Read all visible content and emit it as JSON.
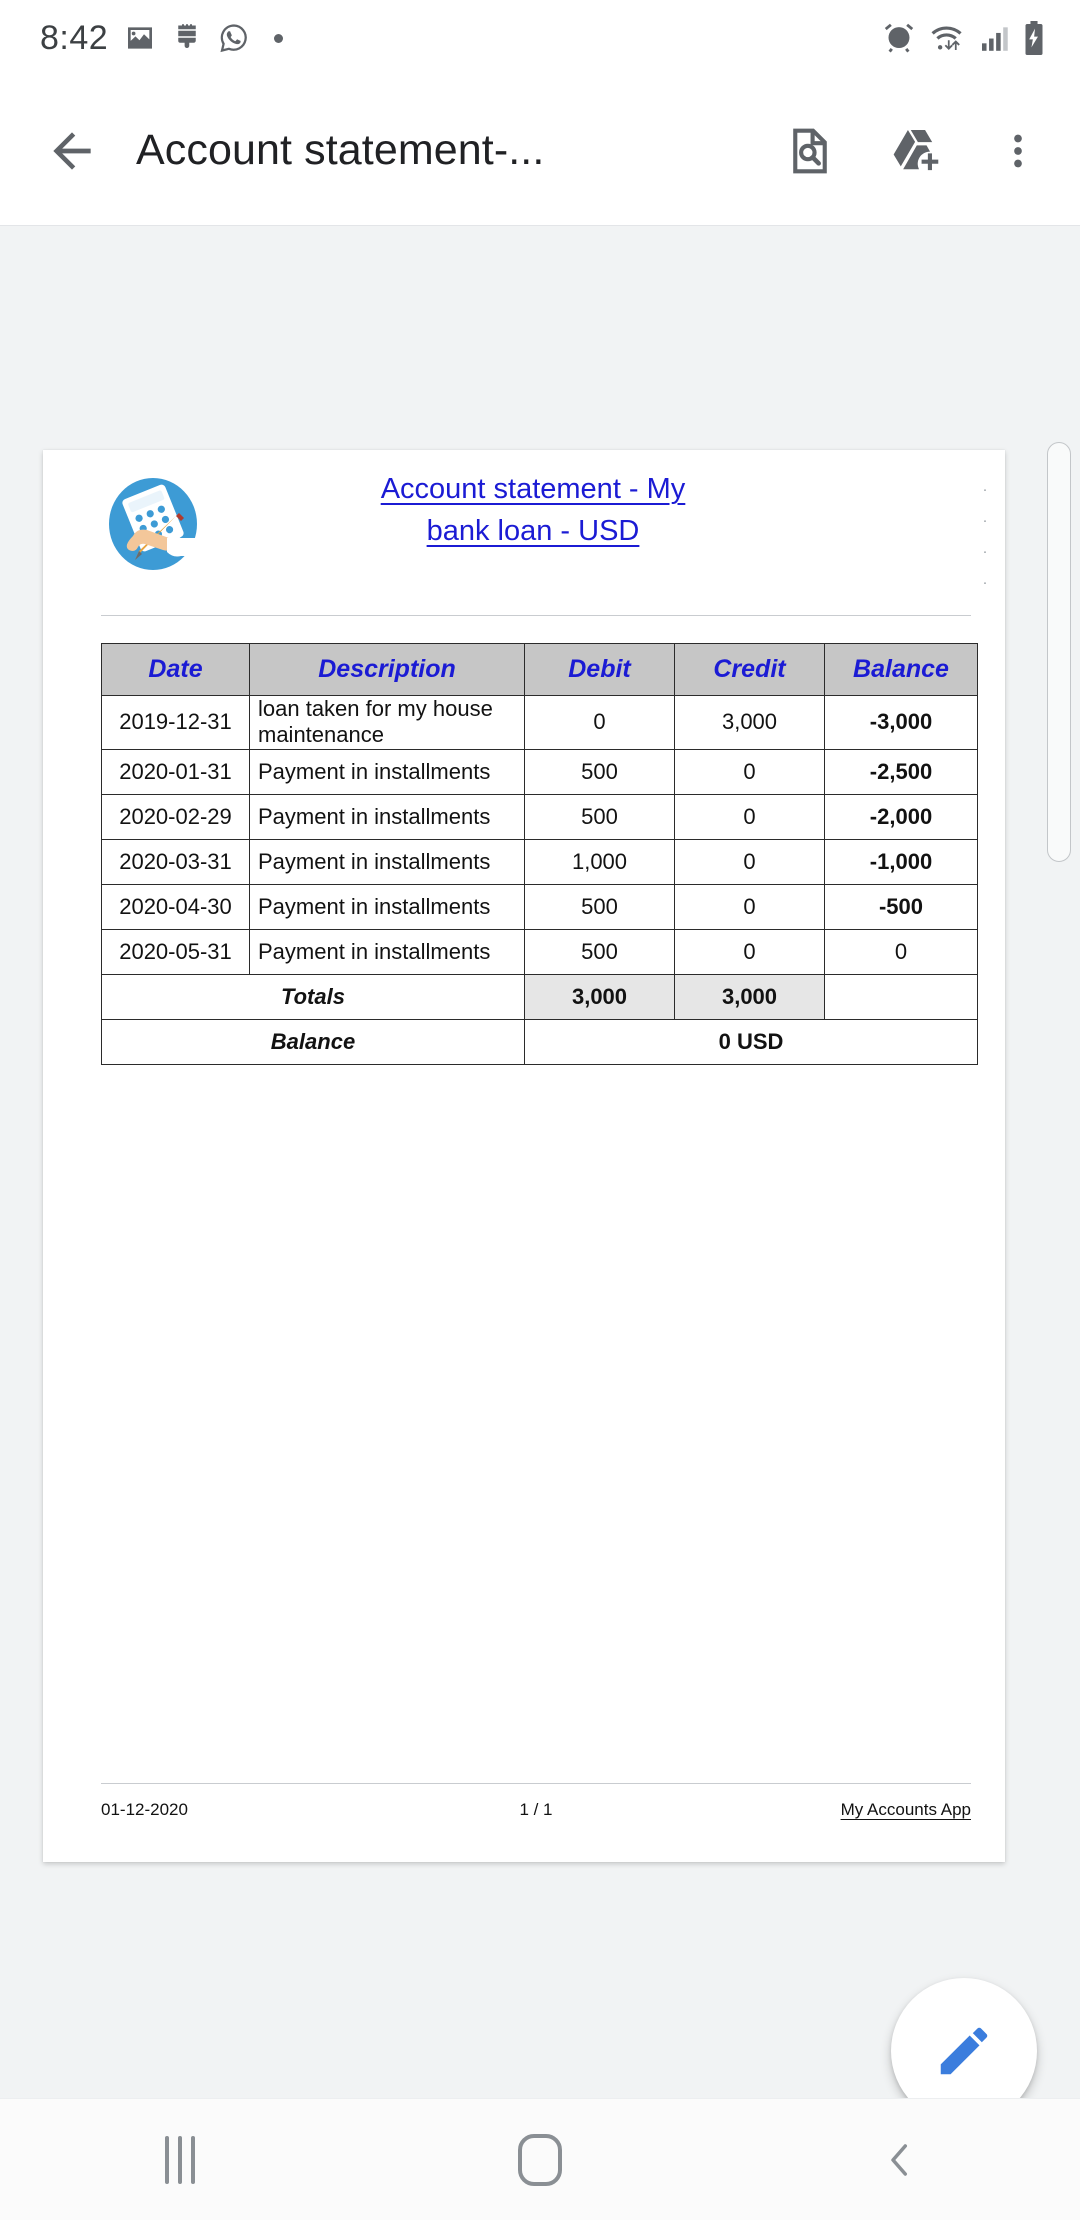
{
  "status_bar": {
    "time": "8:42",
    "left_icons": [
      "image-icon",
      "paintbrush-icon",
      "whatsapp-icon",
      "dot-indicator"
    ],
    "right_icons": [
      "alarm-icon",
      "wifi-icon",
      "signal-icon",
      "battery-charging-icon"
    ]
  },
  "app_bar": {
    "back_label": "back-arrow",
    "title": "Account statement-...",
    "actions": [
      "find-in-document-icon",
      "add-to-drive-icon",
      "overflow-menu-icon"
    ]
  },
  "document": {
    "logo_alt": "accounting-logo",
    "title_line1": "Account statement - My",
    "title_line2": "bank loan - USD",
    "table": {
      "headers": [
        "Date",
        "Description",
        "Debit",
        "Credit",
        "Balance"
      ],
      "rows": [
        {
          "date": "2019-12-31",
          "description": "loan taken for my house maintenance",
          "debit": "0",
          "credit": "3,000",
          "balance": "-3,000",
          "balance_color": "green"
        },
        {
          "date": "2020-01-31",
          "description": "Payment in installments",
          "debit": "500",
          "credit": "0",
          "balance": "-2,500",
          "balance_color": "green"
        },
        {
          "date": "2020-02-29",
          "description": "Payment in installments",
          "debit": "500",
          "credit": "0",
          "balance": "-2,000",
          "balance_color": "green"
        },
        {
          "date": "2020-03-31",
          "description": "Payment in installments",
          "debit": "1,000",
          "credit": "0",
          "balance": "-1,000",
          "balance_color": "green"
        },
        {
          "date": "2020-04-30",
          "description": "Payment in installments",
          "debit": "500",
          "credit": "0",
          "balance": "-500",
          "balance_color": "green"
        },
        {
          "date": "2020-05-31",
          "description": "Payment in installments",
          "debit": "500",
          "credit": "0",
          "balance": "0",
          "balance_color": "black"
        }
      ],
      "totals": {
        "label": "Totals",
        "debit": "3,000",
        "credit": "3,000"
      },
      "balance": {
        "label": "Balance",
        "value": "0 USD"
      }
    },
    "footer": {
      "date": "01-12-2020",
      "page": "1 / 1",
      "app_name": "My Accounts App"
    }
  },
  "fab": {
    "icon": "edit-pencil-icon"
  },
  "nav_bar": {
    "recents": "recents-button",
    "home": "home-button",
    "back": "back-button"
  },
  "colors": {
    "title_blue": "#1b1bd4",
    "positive_green": "#0b7a18",
    "debit_red": "#9e1b1b",
    "credit_green": "#0b9419",
    "header_gray": "#c6c6c6",
    "fab_blue": "#3b7ddd",
    "page_bg": "#f1f3f4"
  }
}
